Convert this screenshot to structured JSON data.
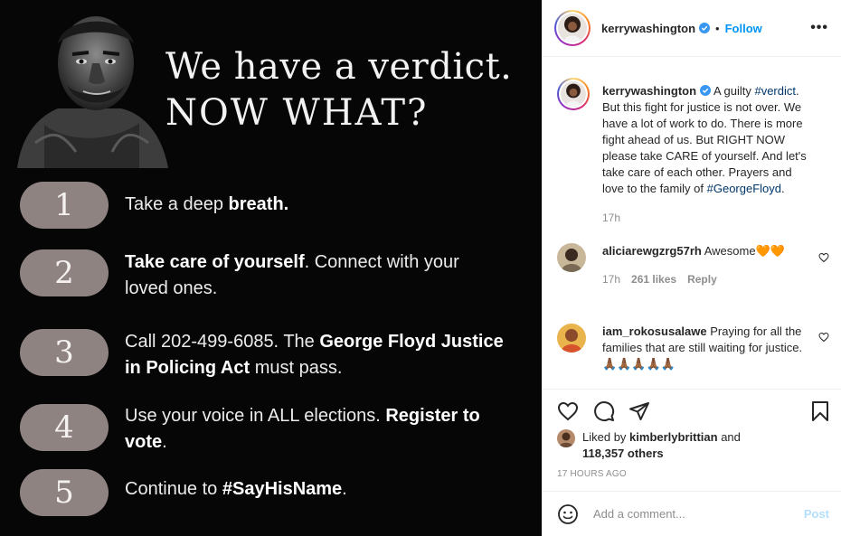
{
  "image": {
    "headline_line1": "We have a verdict.",
    "headline_line2": "NOW WHAT?",
    "steps": [
      {
        "number": "1",
        "parts": [
          {
            "t": "Take a deep ",
            "b": false
          },
          {
            "t": "breath.",
            "b": true
          }
        ]
      },
      {
        "number": "2",
        "parts": [
          {
            "t": "Take care of yourself",
            "b": true
          },
          {
            "t": ". Connect with your loved ones.",
            "b": false
          }
        ]
      },
      {
        "number": "3",
        "parts": [
          {
            "t": "Call 202-499-6085.  The ",
            "b": false
          },
          {
            "t": "George Floyd Justice in Policing Act",
            "b": true
          },
          {
            "t": " must pass.",
            "b": false
          }
        ]
      },
      {
        "number": "4",
        "parts": [
          {
            "t": "Use your voice in ALL elections. ",
            "b": false
          },
          {
            "t": "Register to vote",
            "b": true
          },
          {
            "t": ".",
            "b": false
          }
        ]
      },
      {
        "number": "5",
        "parts": [
          {
            "t": "Continue to ",
            "b": false
          },
          {
            "t": "#SayHisName",
            "b": true
          },
          {
            "t": ".",
            "b": false
          }
        ]
      }
    ]
  },
  "header": {
    "username": "kerrywashington",
    "separator": "•",
    "follow_label": "Follow",
    "more_label": "•••"
  },
  "caption": {
    "username": "kerrywashington",
    "text_1": "A guilty ",
    "hashtag_1": "#verdict",
    "text_2": ". But this fight for justice is not over. We have a lot of work to do. There is more fight ahead of us. But RIGHT NOW please take CARE of yourself. And let's take care of each other. Prayers and love to the family of ",
    "hashtag_2": "#GeorgeFloyd",
    "text_3": ".",
    "time": "17h"
  },
  "comments": [
    {
      "username": "aliciarewgzrg57rh",
      "text": "Awesome",
      "emoji": "🧡🧡",
      "time": "17h",
      "likes": "261 likes",
      "reply": "Reply"
    },
    {
      "username": "iam_rokosusalawe",
      "text": "Praying for all the families that are still waiting for justice.",
      "emoji": "🙏🏾🙏🏾🙏🏾🙏🏾🙏🏾"
    }
  ],
  "likes": {
    "prefix": "Liked by ",
    "user": "kimberlybrittian",
    "middle": " and",
    "count": "118,357 others"
  },
  "timestamp": "17 HOURS AGO",
  "add_comment": {
    "placeholder": "Add a comment...",
    "post_label": "Post"
  },
  "colors": {
    "accent": "#0095f6",
    "hashtag": "#00376b",
    "badge": "#8e8381",
    "post_disabled": "#b2dffc"
  }
}
